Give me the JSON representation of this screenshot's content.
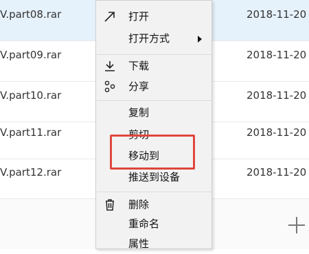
{
  "files": [
    {
      "name": "V.part08.rar",
      "date": "2018-11-20",
      "selected": true
    },
    {
      "name": "V.part09.rar",
      "date": "2018-11-20",
      "selected": false
    },
    {
      "name": "V.part10.rar",
      "date": "2018-11-20",
      "selected": false
    },
    {
      "name": "V.part11.rar",
      "date": "2018-11-20",
      "selected": false
    },
    {
      "name": "V.part12.rar",
      "date": "2018-11-20",
      "selected": false
    }
  ],
  "menu": {
    "open": "打开",
    "open_with": "打开方式",
    "download": "下载",
    "share": "分享",
    "copy": "复制",
    "cut": "剪切",
    "move_to": "移动到",
    "push_to_device": "推送到设备",
    "delete": "删除",
    "rename": "重命名",
    "properties": "属性"
  },
  "icons": {
    "open": "arrow-up-right-icon",
    "download": "download-icon",
    "share": "share-icon",
    "delete": "trash-icon"
  },
  "colors": {
    "selected_row": "#e5f1fb",
    "menu_bg": "#f2f2f2",
    "highlight": "#e0463b"
  }
}
